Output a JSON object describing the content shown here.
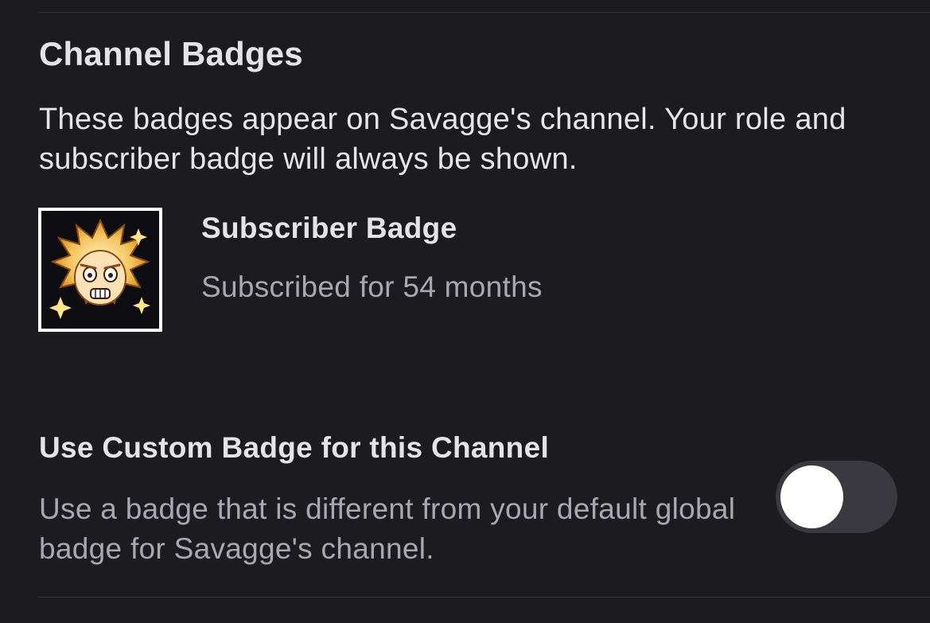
{
  "channel_badges": {
    "title": "Channel Badges",
    "description": "These badges appear on Savagge's channel. Your role and subscriber badge will always be shown."
  },
  "subscriber_badge": {
    "name": "Subscriber Badge",
    "duration": "Subscribed for 54 months",
    "icon": "subscriber-badge-icon"
  },
  "custom_badge_setting": {
    "title": "Use Custom Badge for this Channel",
    "description": "Use a badge that is different from your default global badge for Savagge's channel.",
    "enabled": false
  },
  "colors": {
    "background": "#1c1b20",
    "primary_text": "#e4e3e8",
    "secondary_text": "#a9a8b1",
    "toggle_track": "#3a393f",
    "toggle_knob": "#ffffff"
  }
}
